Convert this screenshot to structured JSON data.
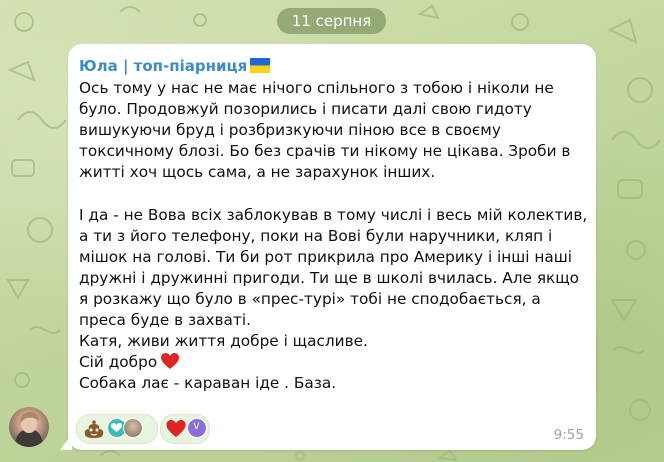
{
  "chat": {
    "date_separator": "11 серпня"
  },
  "message": {
    "sender_name": "Юла | топ-піарниця",
    "sender_flag_icon": "ukraine-flag",
    "sender_color": "#3c8cc8",
    "paragraph_1": "Ось тому у нас не має нічого спільного з тобою і ніколи не було. Продовжуй позорились і писати далі свою гидоту вишукуючи бруд і розбризкуючи піною все в своєму токсичному блозі. Бо без срачів ти нікому не цікава. Зроби в житті хоч щось сама, а не зарахунок інших.",
    "paragraph_2": "І да - не Вова всіх заблокував в тому числі і весь мій колектив, а ти з його телефону, поки на Вові були наручники, кляп і мішок на голові. Ти би рот прикрила про Америку і інші наші дружні і дружинні пригоди. Ти ще в школі вчилась. Але якщо я розкажу що було в «прес-турі» тобі не сподобається, а преса буде в захваті.",
    "line_3": "Катя, живи життя добре і щасливе.",
    "line_4": "Сій добро",
    "line_4_emoji": "red-heart",
    "line_5": "Собака лає - караван іде . База.",
    "time": "9:55"
  },
  "reactions": [
    {
      "emoji": "pile-of-poo",
      "reactor_avatars": [
        "teal-avatar",
        "photo-avatar"
      ]
    },
    {
      "emoji": "red-heart",
      "reactor_avatars": [
        "letter-v-avatar"
      ]
    }
  ],
  "reactor_initial": "V"
}
